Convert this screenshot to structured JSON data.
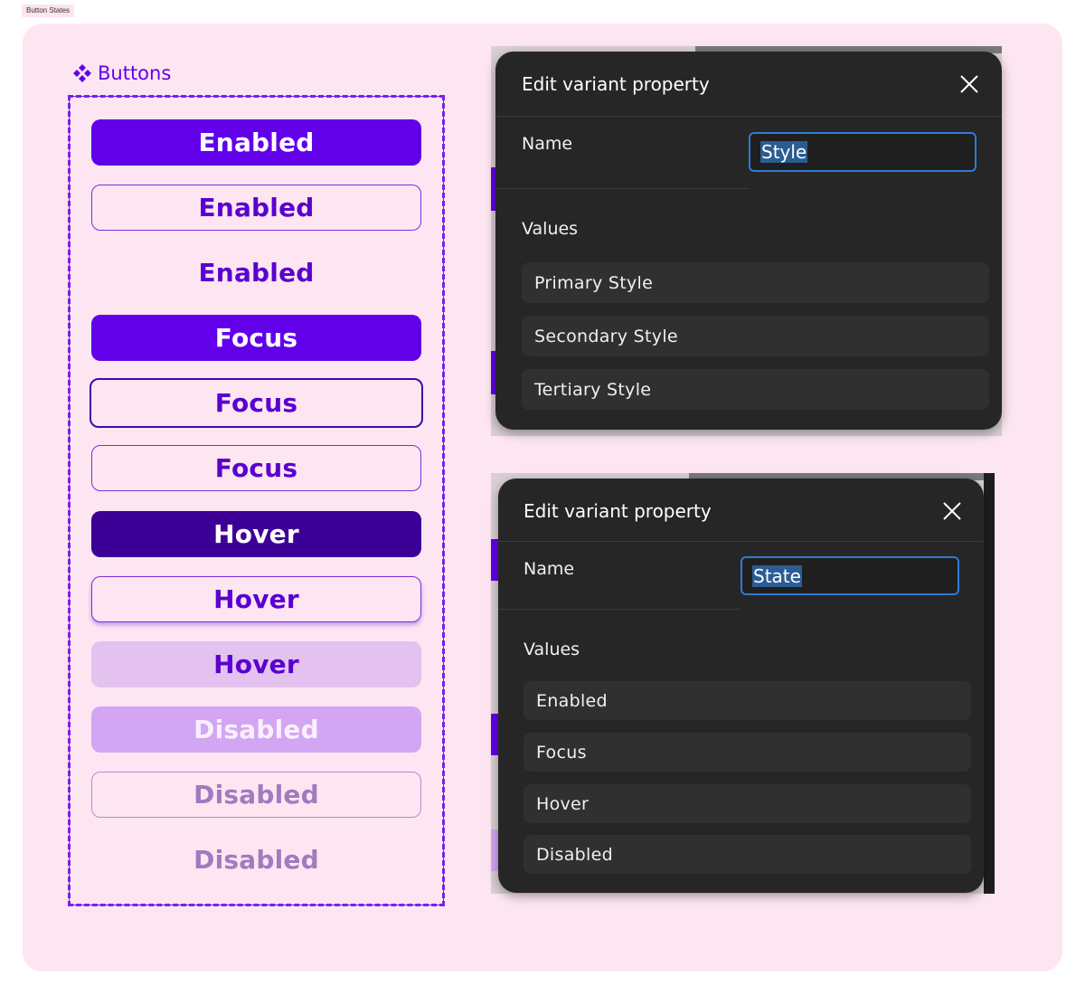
{
  "frame_tag": "Button States",
  "component": {
    "label": "Buttons",
    "icon": "component-diamond-icon",
    "accent": "#6200ea"
  },
  "buttons": [
    {
      "label": "Enabled",
      "style": "primary",
      "state": "enabled"
    },
    {
      "label": "Enabled",
      "style": "secondary",
      "state": "enabled"
    },
    {
      "label": "Enabled",
      "style": "tertiary",
      "state": "enabled"
    },
    {
      "label": "Focus",
      "style": "primary",
      "state": "focus"
    },
    {
      "label": "Focus",
      "style": "secondary",
      "state": "focus"
    },
    {
      "label": "Focus",
      "style": "tertiary",
      "state": "focus"
    },
    {
      "label": "Hover",
      "style": "primary",
      "state": "hover"
    },
    {
      "label": "Hover",
      "style": "secondary",
      "state": "hover"
    },
    {
      "label": "Hover",
      "style": "tertiary",
      "state": "hover"
    },
    {
      "label": "Disabled",
      "style": "primary",
      "state": "disabled"
    },
    {
      "label": "Disabled",
      "style": "secondary",
      "state": "disabled"
    },
    {
      "label": "Disabled",
      "style": "tertiary",
      "state": "disabled"
    }
  ],
  "dialogs": [
    {
      "title": "Edit variant property",
      "name_label": "Name",
      "name_value": "Style",
      "values_label": "Values",
      "values": [
        "Primary Style",
        "Secondary Style",
        "Tertiary Style"
      ]
    },
    {
      "title": "Edit variant property",
      "name_label": "Name",
      "name_value": "State",
      "values_label": "Values",
      "values": [
        "Enabled",
        "Focus",
        "Hover",
        "Disabled"
      ]
    }
  ],
  "colors": {
    "canvas": "#fde6f1",
    "primary": "#6200ea",
    "primary_hover": "#3d0097",
    "tertiary_hover_bg": "#e3c2f0",
    "disabled_bg": "#d2a6f2",
    "dialog_bg": "#262626",
    "input_border": "#2e7bd6",
    "selection": "#2b5c93"
  }
}
